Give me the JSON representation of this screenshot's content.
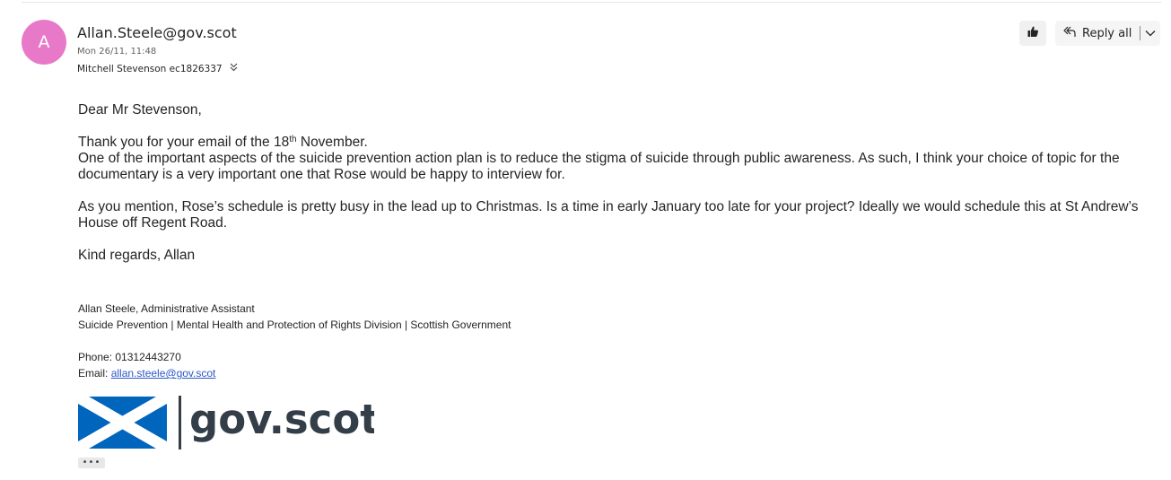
{
  "message": {
    "avatar_initial": "A",
    "sender": "Allan.Steele@gov.scot",
    "date": "Mon 26/11, 11:48",
    "recipients": "Mitchell Stevenson ec1826337",
    "expand_recipients_icon": "double-chevron-down-icon"
  },
  "actions": {
    "like_icon": "thumbs-up-icon",
    "reply_all_label": "Reply all",
    "reply_all_icon": "reply-all-icon",
    "more_actions_icon": "chevron-down-icon"
  },
  "body": {
    "greeting": "Dear Mr Stevenson,",
    "thanks_prefix": "Thank you for your email of the 18",
    "thanks_sup": "th",
    "thanks_suffix": " November.",
    "paragraph1": "One of the important aspects of the suicide prevention action plan is to reduce the stigma of suicide through public awareness. As such, I think your choice of topic for the documentary is a very important one that Rose would be happy to interview for.",
    "paragraph2": "As you mention, Rose’s schedule is pretty busy in the lead up to Christmas. Is a time in early January too late for your project? Ideally we would schedule this at St Andrew’s House off Regent Road.",
    "closing": "Kind regards, Allan"
  },
  "signature": {
    "name_line": "Allan Steele, Administrative Assistant",
    "org_line": "Suicide Prevention | Mental Health and Protection of Rights Division | Scottish Government",
    "phone_line": "Phone: 01312443270",
    "email_label": "Email: ",
    "email_link": "allan.steele@gov.scot",
    "logo_text": "gov.scot",
    "logo_colors": {
      "flag_blue": "#0065bd",
      "flag_white": "#ffffff",
      "text": "#333e48"
    }
  },
  "show_more_label": "•••",
  "colors": {
    "avatar_bg": "#e879c8",
    "link": "#2b57c7"
  }
}
